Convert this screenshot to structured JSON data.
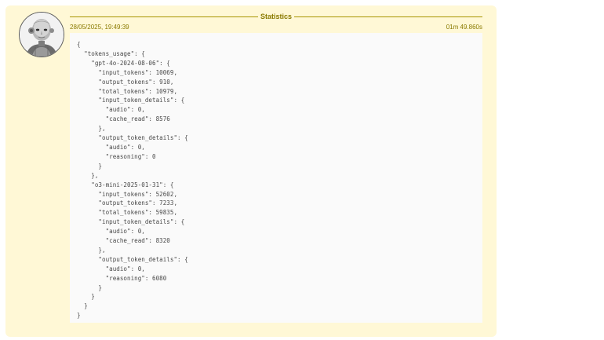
{
  "header": {
    "title": "Statistics",
    "timestamp": "28/05/2025, 19:49:39",
    "duration": "01m 49.860s"
  },
  "avatar": {
    "icon": "robot-avatar-icon"
  },
  "json_lines": [
    "{",
    "  \"tokens_usage\": {",
    "    \"gpt-4o-2024-08-06\": {",
    "      \"input_tokens\": 10069,",
    "      \"output_tokens\": 910,",
    "      \"total_tokens\": 10979,",
    "      \"input_token_details\": {",
    "        \"audio\": 0,",
    "        \"cache_read\": 8576",
    "      },",
    "      \"output_token_details\": {",
    "        \"audio\": 0,",
    "        \"reasoning\": 0",
    "      }",
    "    },",
    "    \"o3-mini-2025-01-31\": {",
    "      \"input_tokens\": 52602,",
    "      \"output_tokens\": 7233,",
    "      \"total_tokens\": 59835,",
    "      \"input_token_details\": {",
    "        \"audio\": 0,",
    "        \"cache_read\": 8320",
    "      },",
    "      \"output_token_details\": {",
    "        \"audio\": 0,",
    "        \"reasoning\": 6080",
    "      }",
    "    }",
    "  }",
    "}"
  ],
  "colors": {
    "card_background": "#fff8d6",
    "accent": "#8a7a00",
    "rule": "#a89400",
    "panel_background": "#fafafa",
    "code_text": "#333333"
  }
}
